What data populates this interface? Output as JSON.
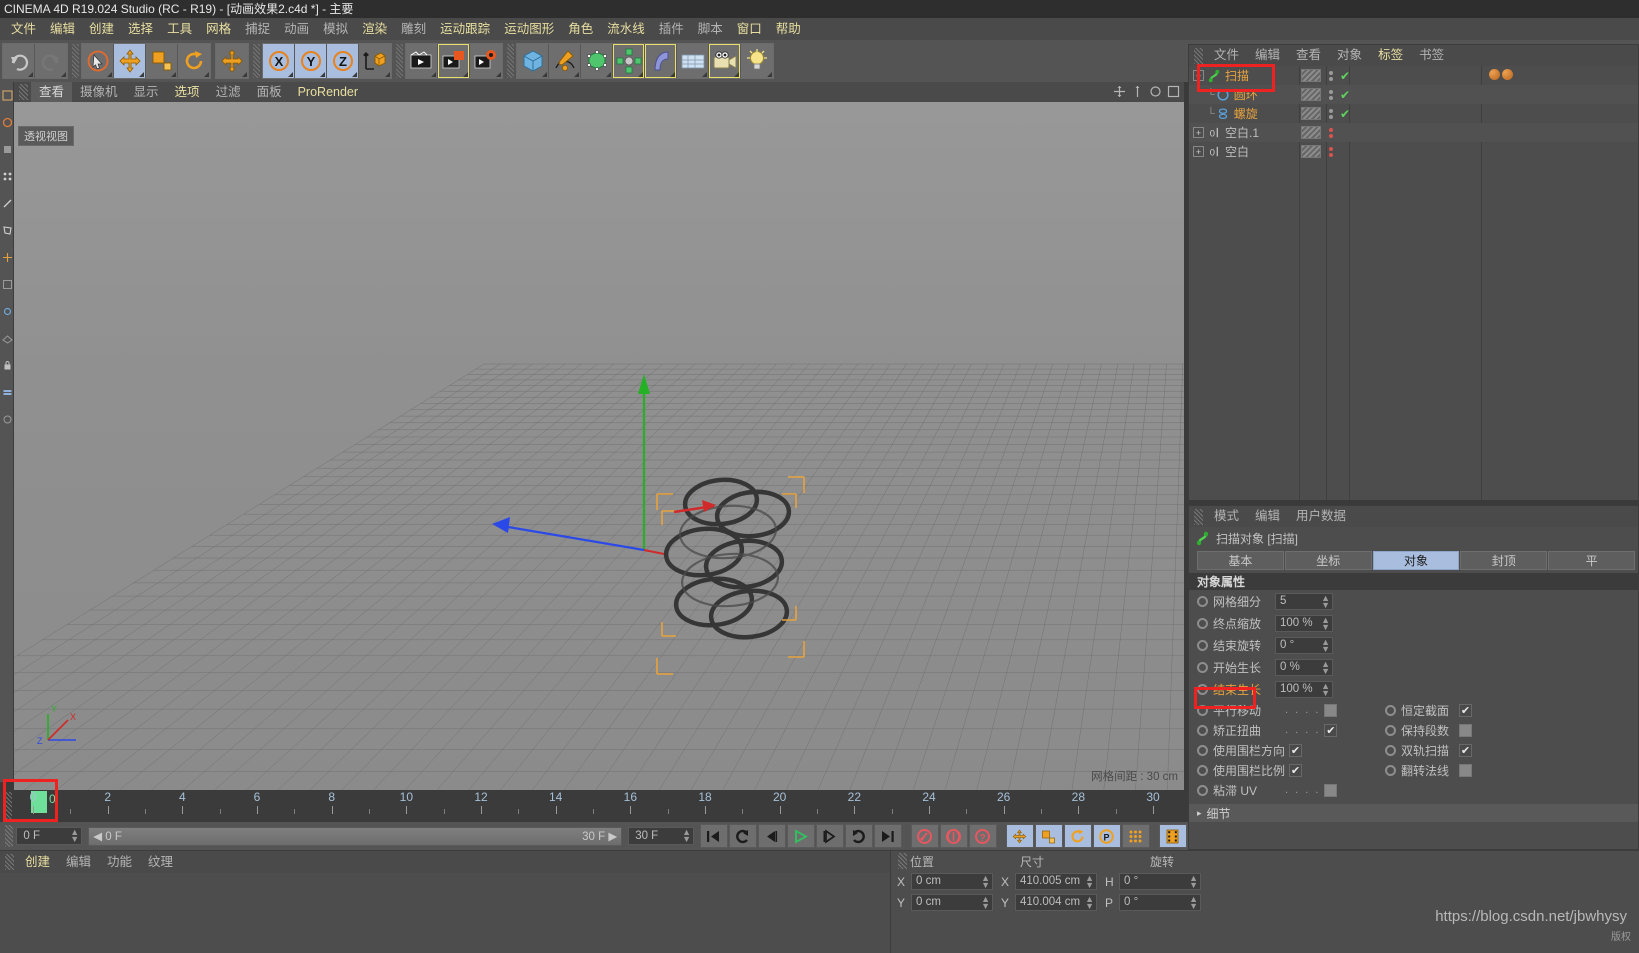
{
  "titlebar": {
    "text": "CINEMA 4D R19.024 Studio (RC - R19) - [动画效果2.c4d *] - 主要"
  },
  "menubar": {
    "items": [
      {
        "label": "文件",
        "style": "y"
      },
      {
        "label": "编辑",
        "style": "y"
      },
      {
        "label": "创建",
        "style": "y"
      },
      {
        "label": "选择",
        "style": "y"
      },
      {
        "label": "工具",
        "style": "y"
      },
      {
        "label": "网格",
        "style": "y"
      },
      {
        "label": "捕捉",
        "style": "g"
      },
      {
        "label": "动画",
        "style": "g"
      },
      {
        "label": "模拟",
        "style": "g"
      },
      {
        "label": "渲染",
        "style": "y"
      },
      {
        "label": "雕刻",
        "style": "g"
      },
      {
        "label": "运动跟踪",
        "style": "y"
      },
      {
        "label": "运动图形",
        "style": "y"
      },
      {
        "label": "角色",
        "style": "y"
      },
      {
        "label": "流水线",
        "style": "y"
      },
      {
        "label": "插件",
        "style": "g"
      },
      {
        "label": "脚本",
        "style": "g"
      },
      {
        "label": "窗口",
        "style": "y"
      },
      {
        "label": "帮助",
        "style": "y"
      }
    ]
  },
  "toolbar": {
    "groups": [
      {
        "name": "undo-redo",
        "buttons": [
          {
            "icon": "undo-icon",
            "state": "normal"
          },
          {
            "icon": "redo-icon",
            "state": "disabled"
          }
        ]
      },
      {
        "name": "mode-tools",
        "buttons": [
          {
            "icon": "select-live-icon",
            "state": "normal"
          },
          {
            "icon": "move-icon",
            "state": "selected"
          },
          {
            "icon": "scale-icon",
            "state": "normal"
          },
          {
            "icon": "rotate-icon",
            "state": "normal"
          }
        ]
      },
      {
        "name": "move-dup",
        "buttons": [
          {
            "icon": "move-icon",
            "state": "normal"
          }
        ]
      },
      {
        "name": "axis-locks",
        "buttons": [
          {
            "icon": "x-axis-icon",
            "state": "selected",
            "label": "X"
          },
          {
            "icon": "y-axis-icon",
            "state": "selected",
            "label": "Y"
          },
          {
            "icon": "z-axis-icon",
            "state": "selected",
            "label": "Z"
          },
          {
            "icon": "world-object-coord-icon",
            "state": "normal"
          }
        ]
      },
      {
        "name": "render-tools",
        "buttons": [
          {
            "icon": "render-view-icon",
            "state": "normal"
          },
          {
            "icon": "render-region-icon",
            "state": "highlight"
          },
          {
            "icon": "render-settings-icon",
            "state": "normal"
          }
        ]
      },
      {
        "name": "create-tools",
        "buttons": [
          {
            "icon": "cube-primitive-icon",
            "state": "normal"
          },
          {
            "icon": "spline-pen-icon",
            "state": "normal"
          },
          {
            "icon": "nurbs-generator-icon",
            "state": "normal"
          },
          {
            "icon": "array-modeling-icon",
            "state": "highlight"
          },
          {
            "icon": "deformer-bend-icon",
            "state": "highlight"
          },
          {
            "icon": "floor-environment-icon",
            "state": "normal"
          },
          {
            "icon": "camera-icon",
            "state": "highlight"
          },
          {
            "icon": "light-icon",
            "state": "normal"
          }
        ]
      }
    ]
  },
  "viewport": {
    "menu": [
      {
        "label": "查看",
        "style": "sel"
      },
      {
        "label": "摄像机",
        "style": "g"
      },
      {
        "label": "显示",
        "style": "g"
      },
      {
        "label": "选项",
        "style": "y"
      },
      {
        "label": "过滤",
        "style": "g"
      },
      {
        "label": "面板",
        "style": "g"
      },
      {
        "label": "ProRender",
        "style": "y"
      }
    ],
    "label": "透视视图",
    "grid_info": "网格间距 : 30 cm",
    "axis_labels": {
      "x": "X",
      "y": "Y",
      "z": "Z"
    }
  },
  "object_manager": {
    "menu": [
      {
        "label": "文件",
        "style": "g"
      },
      {
        "label": "编辑",
        "style": "g"
      },
      {
        "label": "查看",
        "style": "g"
      },
      {
        "label": "对象",
        "style": "g"
      },
      {
        "label": "标签",
        "style": "y"
      },
      {
        "label": "书签",
        "style": "g"
      }
    ],
    "rows": [
      {
        "name": "扫描",
        "icon": "sweep-icon",
        "indent": 0,
        "color": "orange",
        "expander": "+",
        "dots": "grey",
        "check": true,
        "selected": true,
        "materials": 2
      },
      {
        "name": "圆环",
        "icon": "circle-spline-icon",
        "indent": 1,
        "color": "orange",
        "expander": "",
        "dots": "grey",
        "check": true,
        "selected": false,
        "materials": 0
      },
      {
        "name": "螺旋",
        "icon": "helix-spline-icon",
        "indent": 1,
        "color": "orange",
        "expander": "",
        "dots": "grey",
        "check": true,
        "selected": false,
        "materials": 0
      },
      {
        "name": "空白.1",
        "icon": "null-object-icon",
        "indent": 0,
        "color": "grey",
        "expander": "+",
        "dots": "red",
        "check": false,
        "selected": false,
        "materials": 0
      },
      {
        "name": "空白",
        "icon": "null-object-icon",
        "indent": 0,
        "color": "grey",
        "expander": "+",
        "dots": "red",
        "check": false,
        "selected": false,
        "materials": 0
      }
    ]
  },
  "attribute_manager": {
    "menu": [
      {
        "label": "模式",
        "style": "g"
      },
      {
        "label": "编辑",
        "style": "g"
      },
      {
        "label": "用户数据",
        "style": "g"
      }
    ],
    "object_title": "扫描对象 [扫描]",
    "tabs": [
      {
        "label": "基本",
        "selected": false
      },
      {
        "label": "坐标",
        "selected": false
      },
      {
        "label": "对象",
        "selected": true
      },
      {
        "label": "封顶",
        "selected": false
      },
      {
        "label": "平",
        "selected": false
      }
    ],
    "section_title": "对象属性",
    "fields": [
      {
        "label": "网格细分",
        "value": "5",
        "highlight": false
      },
      {
        "label": "终点缩放",
        "value": "100 %",
        "highlight": false
      },
      {
        "label": "结束旋转",
        "value": "0 °",
        "highlight": false
      },
      {
        "label": "开始生长",
        "value": "0 %",
        "highlight": false
      },
      {
        "label": "结束生长",
        "value": "100 %",
        "highlight": true
      }
    ],
    "checkbox_rows": [
      {
        "left_label": "平行移动",
        "left_dots": ". . . .",
        "left_checked": false,
        "right_label": "恒定截面",
        "right_checked": true
      },
      {
        "left_label": "矫正扭曲",
        "left_dots": ". . . .",
        "left_checked": true,
        "right_label": "保持段数",
        "right_checked": false
      },
      {
        "left_label": "使用围栏方向",
        "left_dots": "",
        "left_checked": true,
        "right_label": "双轨扫描",
        "right_checked": true
      },
      {
        "left_label": "使用围栏比例",
        "left_dots": "",
        "left_checked": true,
        "right_label": "翻转法线",
        "right_checked": false
      },
      {
        "left_label": "粘滞 UV",
        "left_dots": ". . . .",
        "left_checked": false,
        "right_label": "",
        "right_checked": null
      }
    ],
    "footer": "细节",
    "footer_arrow": "▸"
  },
  "timeline": {
    "ticks": [
      "0",
      "2",
      "4",
      "6",
      "8",
      "10",
      "12",
      "14",
      "16",
      "18",
      "20",
      "22",
      "24",
      "26",
      "28",
      "30"
    ],
    "current_frame_label": "0",
    "cursor_frame": 0
  },
  "transport": {
    "current_frame_field": "0 F",
    "slider_left_label": "0 F",
    "slider_right_label": "30 F",
    "end_frame_field": "30 F",
    "buttons": [
      {
        "icon": "go-to-start-icon",
        "state": "normal"
      },
      {
        "icon": "previous-keyframe-icon",
        "state": "normal"
      },
      {
        "icon": "step-back-icon",
        "state": "normal"
      },
      {
        "icon": "play-icon",
        "state": "normal"
      },
      {
        "icon": "step-forward-icon",
        "state": "normal"
      },
      {
        "icon": "next-keyframe-icon",
        "state": "normal"
      },
      {
        "icon": "go-to-end-icon",
        "state": "normal"
      },
      {
        "icon": "record-keyframe-icon",
        "state": "normal"
      },
      {
        "icon": "autokey-icon",
        "state": "normal"
      },
      {
        "icon": "keyframe-selection-icon",
        "state": "normal"
      },
      {
        "icon": "position-key-icon",
        "state": "selected"
      },
      {
        "icon": "scale-key-icon",
        "state": "selected"
      },
      {
        "icon": "rotation-key-icon",
        "state": "selected"
      },
      {
        "icon": "param-key-icon",
        "state": "selected"
      },
      {
        "icon": "pla-key-icon",
        "state": "normal"
      },
      {
        "icon": "timeline-filmstrip-icon",
        "state": "selected"
      }
    ]
  },
  "material_manager": {
    "menu": [
      {
        "label": "创建",
        "style": "y"
      },
      {
        "label": "编辑",
        "style": "g"
      },
      {
        "label": "功能",
        "style": "g"
      },
      {
        "label": "纹理",
        "style": "g"
      }
    ]
  },
  "coordinate_manager": {
    "headers": [
      "位置",
      "尺寸",
      "旋转"
    ],
    "rows": [
      {
        "axis1": "X",
        "val1": "0 cm",
        "axis2": "X",
        "val2": "410.005 cm",
        "axis3": "H",
        "val3": "0 °"
      },
      {
        "axis2_row": "Y",
        "axis1": "Y",
        "val1": "0 cm",
        "axis2": "Y",
        "val2": "410.004 cm",
        "axis3": "P",
        "val3": "0 °"
      }
    ]
  },
  "watermark": {
    "text": "https://blog.csdn.net/jbwhysy",
    "sub": "版权"
  },
  "colors": {
    "accent_orange": "#e8a33d",
    "selection_blue": "#a9bede",
    "annotation_red": "#ef2222",
    "green_check": "#5fd45f"
  }
}
